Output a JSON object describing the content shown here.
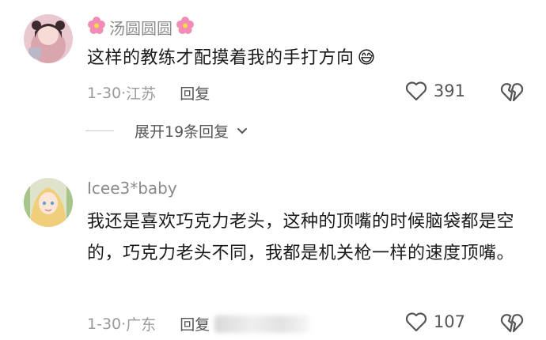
{
  "comments": [
    {
      "username": "汤圆圆圆",
      "content": "这样的教练才配摸着我的手打方向",
      "emoji": "😅",
      "date": "1-30",
      "location": "江苏",
      "reply_label": "回复",
      "likes": "391",
      "expand_label": "展开19条回复"
    },
    {
      "username": "Icee3*baby",
      "content": "我还是喜欢巧克力老头，这种的顶嘴的时候脑袋都是空的，巧克力老头不同，我都是机关枪一样的速度顶嘴。",
      "date": "1-30",
      "location": "广东",
      "reply_label": "回复",
      "likes": "107"
    }
  ],
  "colors": {
    "meta_gray": "#9a9a9a",
    "text_dark": "#1a1a1a",
    "flower_pink": "#f28cb4"
  },
  "icons": [
    "flower-icon",
    "heart-outline-icon",
    "broken-heart-icon",
    "chevron-down-icon",
    "sweat-smile-emoji"
  ]
}
